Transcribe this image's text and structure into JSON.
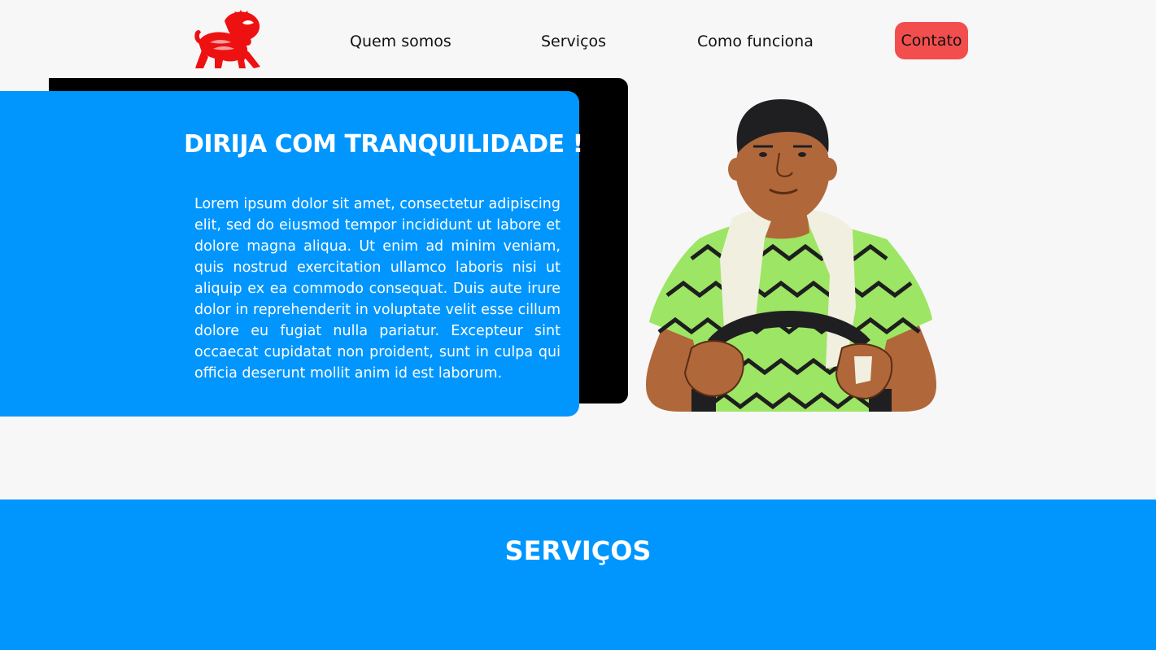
{
  "header": {
    "logo_icon": "lion-logo-icon",
    "nav": {
      "quem_somos": "Quem somos",
      "servicos": "Serviços",
      "como_funciona": "Como funciona",
      "contato": "Contato"
    }
  },
  "hero": {
    "title": "DIRIJA COM TRANQUILIDADE !",
    "text": "Lorem ipsum dolor sit amet, consectetur adipiscing elit, sed do eiusmod tempor incididunt ut labore et dolore magna aliqua. Ut enim ad minim veniam, quis nostrud exercitation ullamco laboris nisi ut aliquip ex ea commodo consequat. Duis aute irure dolor in reprehenderit in voluptate velit esse cillum dolore eu fugiat nulla pariatur. Excepteur sint occaecat cupidatat non proident, sunt in culpa qui officia deserunt mollit anim id est laborum.",
    "illustration": "driver-illustration"
  },
  "services": {
    "title": "SERVIÇOS"
  },
  "colors": {
    "primary_blue": "#0096fe",
    "contact_red": "#f24e4e",
    "background": "#f7f7f7",
    "logo_red": "#ee1111"
  }
}
